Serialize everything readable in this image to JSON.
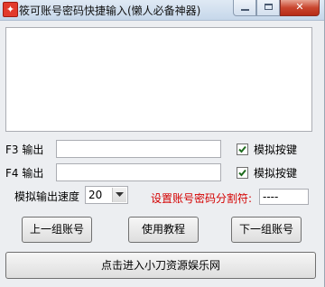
{
  "window": {
    "title": "筱可账号密码快捷输入(懒人必备神器)",
    "icon": "app-icon",
    "controls": [
      "minimize-icon",
      "maximize-icon",
      "close-icon"
    ]
  },
  "text_area": {
    "value": ""
  },
  "rows": {
    "f3": {
      "label": "F3 输出",
      "value": "",
      "checkbox_label": "模拟按键",
      "checked": true
    },
    "f4": {
      "label": "F4 输出",
      "value": "",
      "checkbox_label": "模拟按键",
      "checked": true
    }
  },
  "speed": {
    "label": "模拟输出速度",
    "value": "20"
  },
  "separator": {
    "label": "设置账号密码分割符:",
    "value": "----",
    "label_color": "#d40000"
  },
  "buttons": {
    "prev": "上一组账号",
    "tutorial": "使用教程",
    "next": "下一组账号",
    "link": "点击进入小刀资源娱乐网"
  }
}
